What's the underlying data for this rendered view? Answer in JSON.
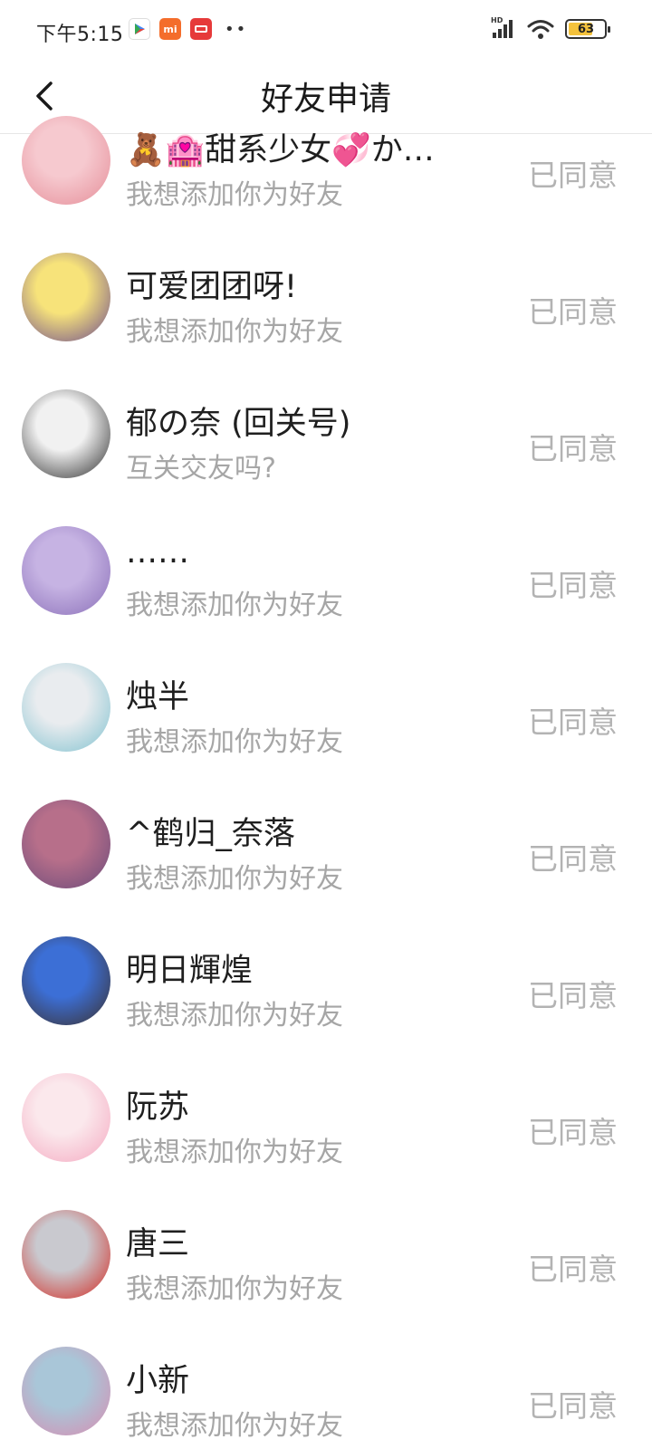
{
  "status_bar": {
    "time": "下午5:15",
    "battery": "63",
    "network": "HD"
  },
  "header": {
    "title": "好友申请"
  },
  "requests": [
    {
      "name": "🧸🏩甜系少女💞か…",
      "message": "我想添加你为好友",
      "status": "已同意",
      "avatar_colors": [
        "#f6c9cf",
        "#e58d98"
      ]
    },
    {
      "name": "可爱团团呀!",
      "message": "我想添加你为好友",
      "status": "已同意",
      "avatar_colors": [
        "#f7e37a",
        "#6b4a8e"
      ]
    },
    {
      "name": "郁の奈 (回关号)",
      "message": "互关交友吗?",
      "status": "已同意",
      "avatar_colors": [
        "#f1f1f1",
        "#2a2a2a"
      ]
    },
    {
      "name": "……",
      "message": "我想添加你为好友",
      "status": "已同意",
      "avatar_colors": [
        "#c6b3e3",
        "#8a6fb8"
      ]
    },
    {
      "name": "烛半",
      "message": "我想添加你为好友",
      "status": "已同意",
      "avatar_colors": [
        "#e9ecef",
        "#7fc1cf"
      ]
    },
    {
      "name": "^鹤归_奈落",
      "message": "我想添加你为好友",
      "status": "已同意",
      "avatar_colors": [
        "#b76f8a",
        "#6a4a7a"
      ]
    },
    {
      "name": "明日輝煌",
      "message": "我想添加你为好友",
      "status": "已同意",
      "avatar_colors": [
        "#3c6fd6",
        "#3b2f2a"
      ]
    },
    {
      "name": "阮苏",
      "message": "我想添加你为好友",
      "status": "已同意",
      "avatar_colors": [
        "#fbe8ec",
        "#f4a8c0"
      ]
    },
    {
      "name": "唐三",
      "message": "我想添加你为好友",
      "status": "已同意",
      "avatar_colors": [
        "#c9c9cf",
        "#d3261e"
      ]
    },
    {
      "name": "小新",
      "message": "我想添加你为好友",
      "status": "已同意",
      "avatar_colors": [
        "#a9c6d8",
        "#d98bb0"
      ]
    }
  ]
}
